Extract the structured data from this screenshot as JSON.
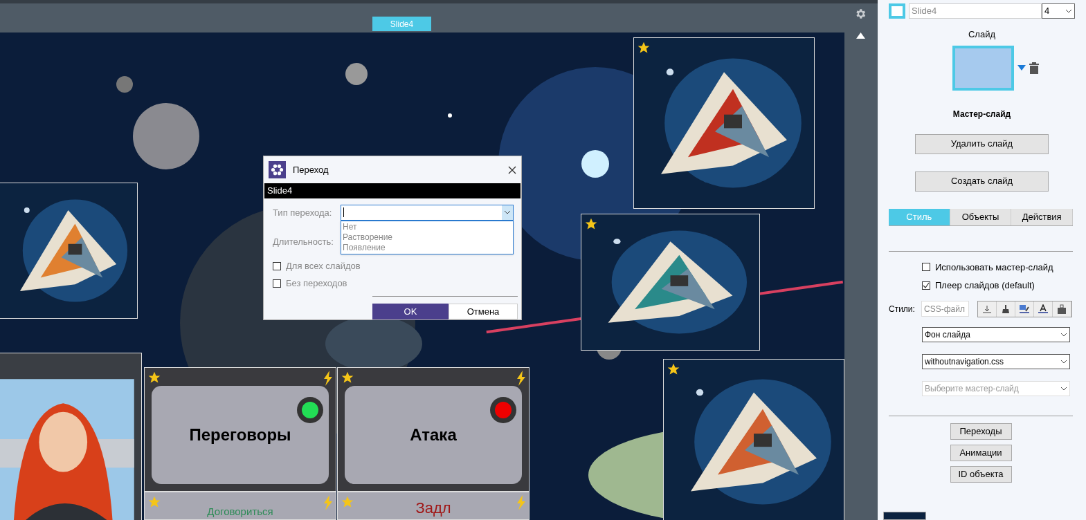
{
  "toolbar": {
    "slide_tab": "Slide4"
  },
  "canvas": {
    "cards": [
      {
        "title": "Переговоры",
        "action": "Договориться",
        "kind": "positive",
        "color": "#22dd55"
      },
      {
        "title": "Атака",
        "action": "Задл",
        "kind": "negative",
        "color": "#ee0000"
      }
    ]
  },
  "dialog": {
    "title": "Переход",
    "slide_name": "Slide4",
    "type_label": "Тип перехода:",
    "type_options": [
      "Нет",
      "Растворение",
      "Появление"
    ],
    "duration_label": "Длительность:",
    "checkboxes": [
      {
        "label": "Для всех слайдов",
        "checked": false
      },
      {
        "label": "Без переходов",
        "checked": false
      }
    ],
    "ok": "OK",
    "cancel": "Отмена"
  },
  "panel": {
    "slide_name": "Slide4",
    "slide_number": "4",
    "slide_label": "Слайд",
    "master_label": "Мастер-слайд",
    "delete_button": "Удалить слайд",
    "create_button": "Создать слайд",
    "tabs": [
      {
        "label": "Стиль",
        "selected": true
      },
      {
        "label": "Объекты",
        "selected": false
      },
      {
        "label": "Действия",
        "selected": false
      }
    ],
    "checkboxes": [
      {
        "label": "Использовать мастер-слайд",
        "checked": false
      },
      {
        "label": "Плеер слайдов (default)",
        "checked": true
      }
    ],
    "styles_label": "Стили:",
    "css_placeholder": "CSS-файл",
    "background_select": "Фон слайда",
    "css_select": "withoutnavigation.css",
    "master_placeholder": "Выберите мастер-слайд",
    "buttons": [
      "Переходы",
      "Анимации",
      "ID объекта"
    ]
  }
}
